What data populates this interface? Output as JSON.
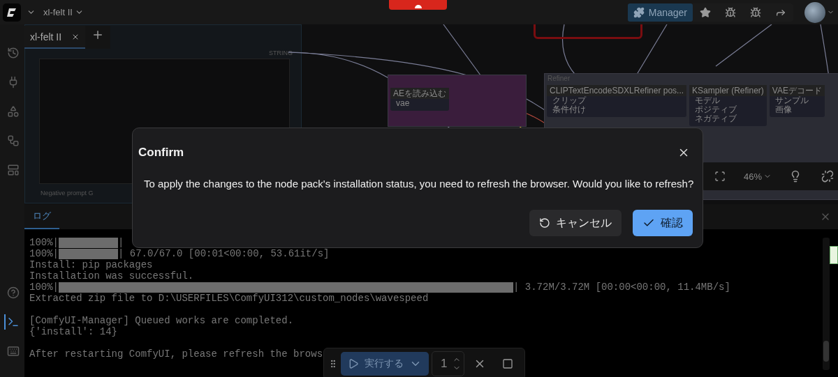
{
  "top_bar": {
    "workflow_menu": "xl-felt II",
    "manager_button": "Manager"
  },
  "workflow_tabs": [
    {
      "label": "xl-felt II",
      "selected": true
    }
  ],
  "sidebar": {
    "items": [
      {
        "kind": "history",
        "selected": false
      },
      {
        "kind": "nodes",
        "selected": false
      },
      {
        "kind": "models",
        "selected": false
      },
      {
        "kind": "workflows",
        "selected": false
      },
      {
        "kind": "templates",
        "selected": false
      }
    ],
    "bottom_items": [
      {
        "kind": "help",
        "selected": false
      },
      {
        "kind": "terminal",
        "selected": true
      },
      {
        "kind": "keyboard",
        "selected": false
      }
    ]
  },
  "canvas": {
    "output_label": "STRING",
    "prompt_node": "Negative prompt G",
    "groups": [
      {
        "color": "#3a1d3c",
        "nodes": [
          {
            "title": "AEを読み込む",
            "slots": [
              "vae"
            ]
          }
        ]
      },
      {
        "title": "Refiner",
        "color": "#2b2c34",
        "nodes": [
          {
            "title": "CLIPTextEncodeSDXLRefiner pos...",
            "slots": [
              "クリップ",
              "条件付け"
            ]
          },
          {
            "title": "KSampler (Refiner)",
            "slots": [
              "モデル",
              "ポジティブ",
              "ネガティブ"
            ]
          },
          {
            "title": "VAEデコード",
            "slots": [
              "サンプル",
              "画像"
            ]
          }
        ]
      }
    ],
    "zoom": "46%"
  },
  "log_panel": {
    "tabs": [
      {
        "label": "ログ",
        "selected": true
      }
    ],
    "lines": [
      {
        "kind": "progress_short",
        "prefix": "100%|",
        "suffix": "|"
      },
      {
        "kind": "progress_short",
        "prefix": "100%|",
        "suffix": "| 67.0/67.0 [00:01<00:00, 53.61it/s]"
      },
      {
        "kind": "text",
        "text": "Install: pip packages"
      },
      {
        "kind": "text",
        "text": "Installation was successful."
      },
      {
        "kind": "progress_long",
        "prefix": "100%|",
        "suffix": "| 3.72M/3.72M [00:00<00:00, 11.4MB/s]"
      },
      {
        "kind": "text",
        "text": "Extracted zip file to D:\\USERFILES\\ComfyUI312\\custom_nodes\\wavespeed"
      },
      {
        "kind": "blank"
      },
      {
        "kind": "text",
        "text": "[ComfyUI-Manager] Queued works are completed."
      },
      {
        "kind": "text",
        "text": "{'install': 14}"
      },
      {
        "kind": "blank"
      },
      {
        "kind": "text",
        "text": "After restarting ComfyUI, please refresh the brows"
      }
    ]
  },
  "dialog": {
    "title": "Confirm",
    "message": "To apply the changes to the node pack's installation status, you need to refresh the browser. Would you like to refresh?",
    "buttons": [
      {
        "label": "キャンセル",
        "kind": "secondary"
      },
      {
        "label": "確認",
        "kind": "primary"
      }
    ]
  },
  "run_toolbar": {
    "run_button": "実行する",
    "batch_count": "1"
  }
}
